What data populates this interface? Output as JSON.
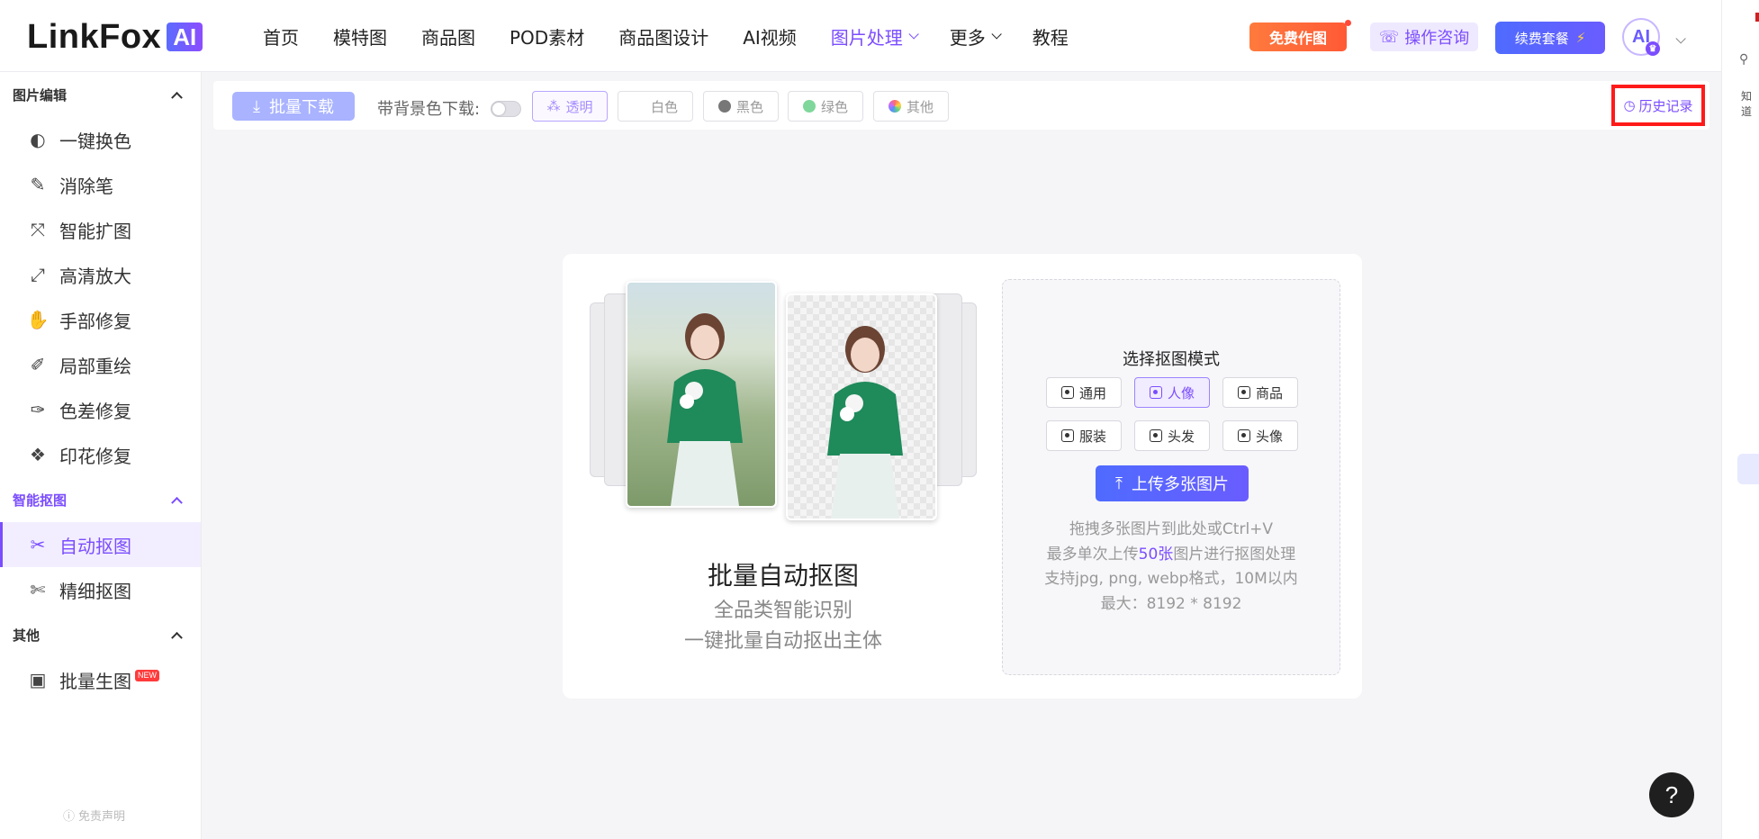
{
  "logo": {
    "text": "LinkFox",
    "badge": "AI"
  },
  "nav": [
    {
      "label": "首页"
    },
    {
      "label": "模特图"
    },
    {
      "label": "商品图"
    },
    {
      "label": "POD素材"
    },
    {
      "label": "商品图设计"
    },
    {
      "label": "AI视频"
    },
    {
      "label": "图片处理",
      "active": true,
      "dropdown": true
    },
    {
      "label": "更多",
      "dropdown": true
    },
    {
      "label": "教程"
    }
  ],
  "header_actions": {
    "free": "免费作图",
    "consult": "操作咨询",
    "renew": "续费套餐",
    "avatar": "AI"
  },
  "right_strip": {
    "text": "知道"
  },
  "sidebar": {
    "sections": [
      {
        "title": "图片编辑",
        "items": [
          "一键换色",
          "消除笔",
          "智能扩图",
          "高清放大",
          "手部修复",
          "局部重绘",
          "色差修复",
          "印花修复"
        ]
      },
      {
        "title": "智能抠图",
        "items": [
          "自动抠图",
          "精细抠图"
        ]
      },
      {
        "title": "其他",
        "items": [
          "批量生图"
        ]
      }
    ],
    "active_item": "自动抠图",
    "new_badge": "NEW",
    "disclaimer": "免责声明"
  },
  "toolbar": {
    "batch_download": "批量下载",
    "bg_label": "带背景色下载:",
    "bg_options": [
      {
        "label": "透明",
        "color": "#f3efff",
        "selected": true
      },
      {
        "label": "白色",
        "color": "#ffffff"
      },
      {
        "label": "黑色",
        "color": "#777777"
      },
      {
        "label": "绿色",
        "color": "#7fd79b"
      },
      {
        "label": "其他",
        "color": "#f6a0c0"
      }
    ],
    "history": "历史记录"
  },
  "card": {
    "title": "批量自动抠图",
    "sub1": "全品类智能识别",
    "sub2": "一键批量自动抠出主体",
    "mode_title": "选择抠图模式",
    "modes": [
      {
        "label": "通用"
      },
      {
        "label": "人像",
        "selected": true
      },
      {
        "label": "商品"
      },
      {
        "label": "服装"
      },
      {
        "label": "头发"
      },
      {
        "label": "头像"
      }
    ],
    "upload": "上传多张图片",
    "hint1": "拖拽多张图片到此处或Ctrl+V",
    "hint2_pre": "最多单次上传",
    "hint2_hl": "50张",
    "hint2_post": "图片进行抠图处理",
    "hint3": "支持jpg, png, webp格式，10M以内",
    "hint4": "最大：8192 * 8192"
  },
  "help": "?"
}
